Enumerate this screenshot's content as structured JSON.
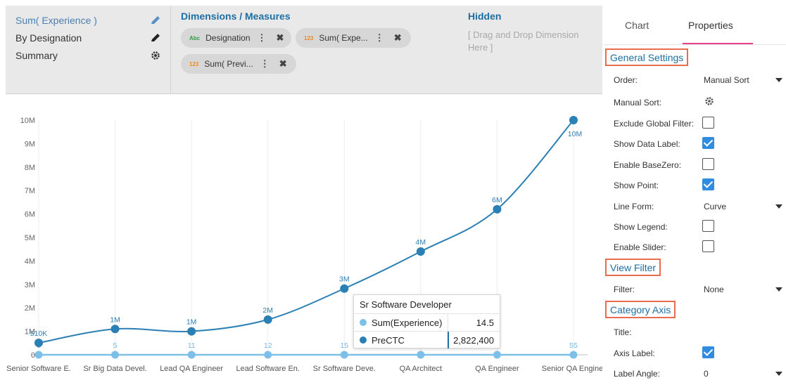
{
  "left_nav": {
    "items": [
      {
        "label": "Sum( Experience )",
        "icon": "pencil-icon"
      },
      {
        "label": "By Designation",
        "icon": "pencil-icon"
      },
      {
        "label": "Summary",
        "icon": "gear-icon"
      }
    ]
  },
  "dimensions": {
    "title": "Dimensions / Measures",
    "chips": [
      {
        "type": "Abc",
        "label": "Designation"
      },
      {
        "type": "123",
        "label": "Sum( Expe..."
      },
      {
        "type": "123",
        "label": "Sum( Previ..."
      }
    ]
  },
  "hidden": {
    "title": "Hidden",
    "hint": "[ Drag and Drop Dimension Here ]"
  },
  "chart_data": {
    "type": "line",
    "categories": [
      "Senior Software E.",
      "Sr Big Data Devel.",
      "Lead QA Engineer",
      "Lead Software En.",
      "Sr Software Deve.",
      "QA Architect",
      "QA Engineer",
      "Senior QA Engine."
    ],
    "y_ticks": [
      "0",
      "1M",
      "2M",
      "3M",
      "4M",
      "5M",
      "6M",
      "7M",
      "8M",
      "9M",
      "10M"
    ],
    "ylim": [
      0,
      10000000
    ],
    "curve": "smooth",
    "grid": "vertical",
    "legend": "none",
    "series": [
      {
        "name": "PreCTC",
        "color": "#2a7fb5",
        "values": [
          510000,
          1100000,
          1000000,
          1500000,
          2822400,
          4400000,
          6200000,
          10000000
        ],
        "labels": [
          "510K",
          "1M",
          "1M",
          "2M",
          "3M",
          "4M",
          "6M",
          "10M"
        ]
      },
      {
        "name": "Sum(Experience)",
        "color": "#7cc0ea",
        "values": [
          1,
          5,
          11,
          12,
          14.5,
          0,
          0,
          55
        ],
        "labels": [
          "1",
          "5",
          "11",
          "12",
          "15",
          "",
          "",
          "55"
        ]
      }
    ]
  },
  "tooltip": {
    "title": "Sr Software Developer",
    "rows": [
      {
        "label": "Sum(Experience)",
        "value": "14.5",
        "color": "#7cc0ea"
      },
      {
        "label": "PreCTC",
        "value": "2,822,400",
        "color": "#2a7fb5"
      }
    ]
  },
  "right_panel": {
    "tabs": [
      "Chart",
      "Properties"
    ],
    "active_tab": "Properties",
    "general": {
      "title": "General Settings",
      "order_label": "Order:",
      "order_value": "Manual Sort",
      "manual_sort_label": "Manual Sort:",
      "exclude_label": "Exclude Global Filter:",
      "exclude": false,
      "show_data_label": "Show Data Label:",
      "show_data": true,
      "basezero_label": "Enable BaseZero:",
      "basezero": false,
      "show_point_label": "Show Point:",
      "show_point": true,
      "line_form_label": "Line Form:",
      "line_form_value": "Curve",
      "show_legend_label": "Show Legend:",
      "show_legend": false,
      "slider_label": "Enable Slider:",
      "slider": false
    },
    "view_filter": {
      "title": "View Filter",
      "filter_label": "Filter:",
      "filter_value": "None"
    },
    "category_axis": {
      "title": "Category Axis",
      "title_label": "Title:",
      "axis_label_label": "Axis Label:",
      "axis_label": true,
      "label_angle_label": "Label Angle:",
      "label_angle_value": "0"
    }
  },
  "colors": {
    "accent": "#1d6fa3",
    "highlight_border": "#e76d4e",
    "tab_underline": "#e9408c",
    "checkbox_on": "#2f8ce0"
  }
}
